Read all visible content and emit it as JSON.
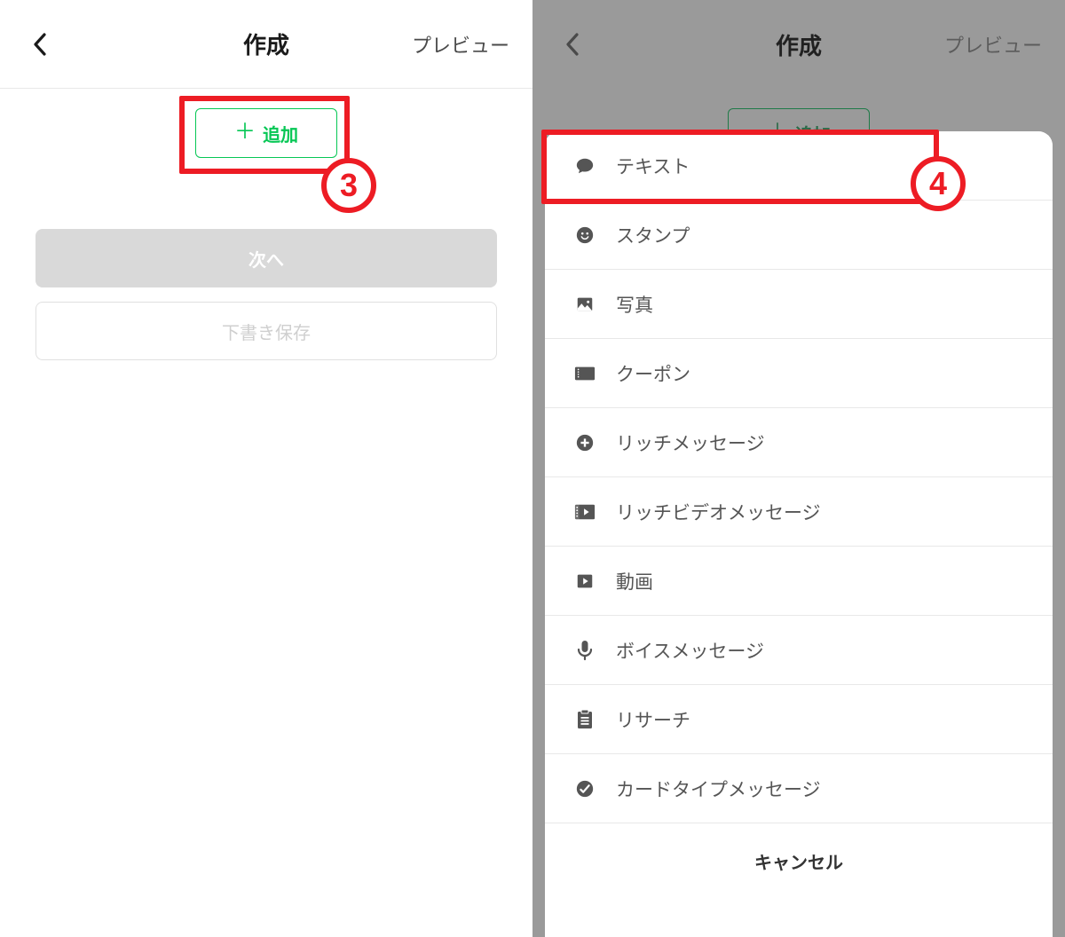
{
  "header": {
    "title": "作成",
    "preview": "プレビュー"
  },
  "left": {
    "add": "追加",
    "next": "次へ",
    "draft": "下書き保存",
    "step_number": "3"
  },
  "right": {
    "step_number": "4",
    "options": [
      {
        "id": "text",
        "label": "テキスト"
      },
      {
        "id": "stamp",
        "label": "スタンプ"
      },
      {
        "id": "photo",
        "label": "写真"
      },
      {
        "id": "coupon",
        "label": "クーポン"
      },
      {
        "id": "rich-msg",
        "label": "リッチメッセージ"
      },
      {
        "id": "rich-video",
        "label": "リッチビデオメッセージ"
      },
      {
        "id": "video",
        "label": "動画"
      },
      {
        "id": "voice",
        "label": "ボイスメッセージ"
      },
      {
        "id": "research",
        "label": "リサーチ"
      },
      {
        "id": "card",
        "label": "カードタイプメッセージ"
      }
    ],
    "cancel": "キャンセル"
  },
  "colors": {
    "accent_green": "#06c755",
    "highlight_red": "#ed1c24"
  }
}
